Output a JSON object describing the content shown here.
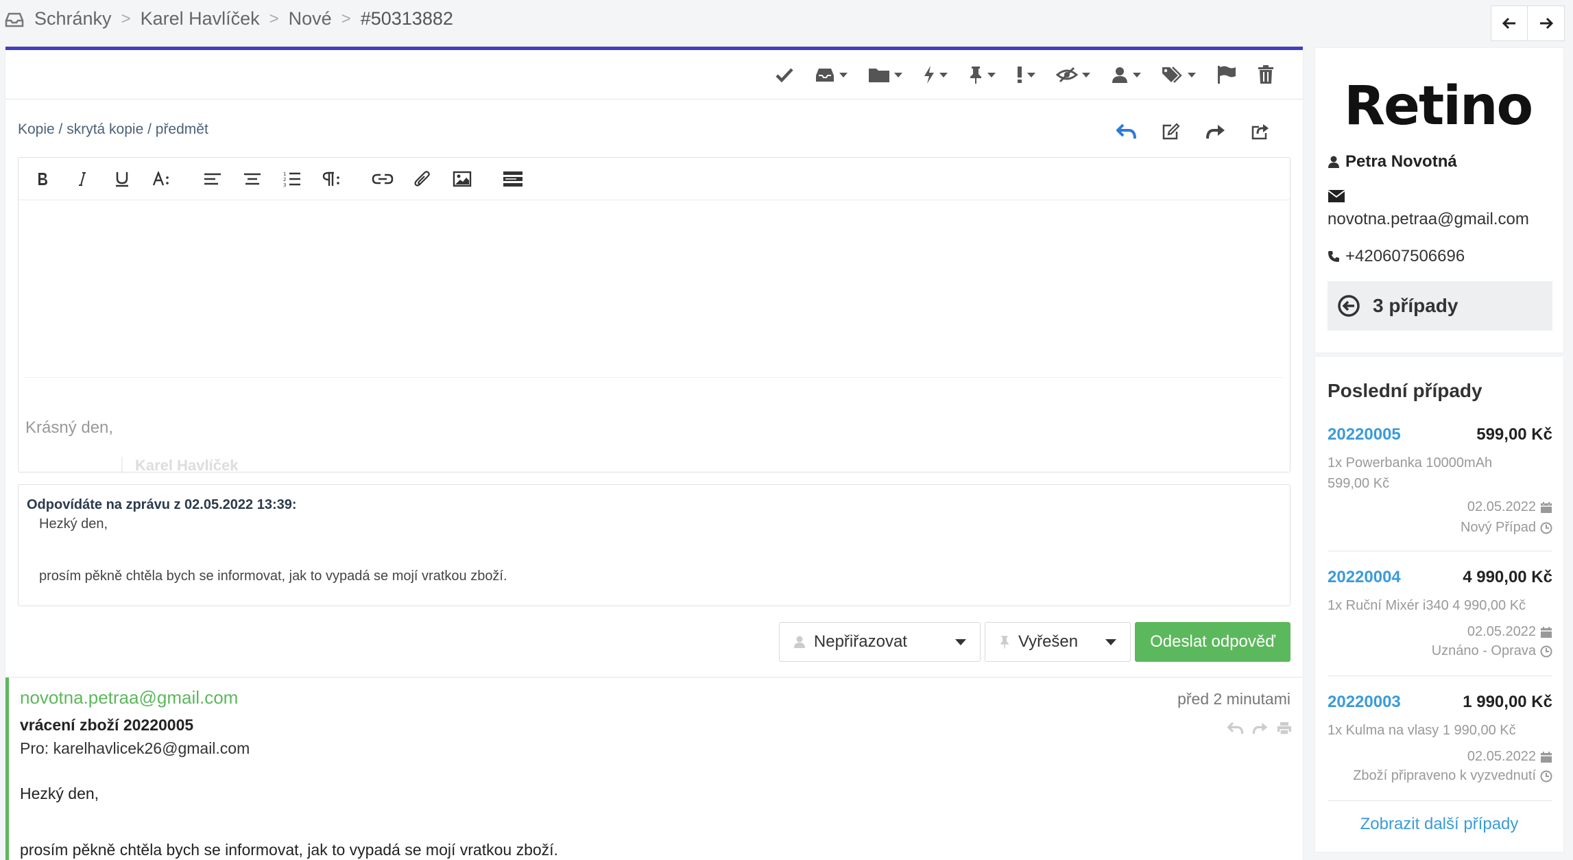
{
  "breadcrumb": [
    "Schránky",
    "Karel Havlíček",
    "Nové",
    "#50313882"
  ],
  "composer": {
    "recipients_link": "Kopie / skrytá kopie / předmět",
    "signature_greeting": "Krásný den,",
    "signature_name": "Karel Havlíček"
  },
  "quoted": {
    "header": "Odpovídáte na zprávu z 02.05.2022 13:39:",
    "line1": "Hezký den,",
    "line2": "prosím pěkně chtěla bych se informovat, jak to vypadá se mojí vratkou zboží."
  },
  "actions": {
    "assign_label": "Nepřiřazovat",
    "status_label": "Vyřešen",
    "send_label": "Odeslat odpověď"
  },
  "message": {
    "from": "novotna.petraa@gmail.com",
    "time": "před 2 minutami",
    "subject": "vrácení zboží 20220005",
    "to": "Pro: karelhavlicek26@gmail.com",
    "body1": "Hezký den,",
    "body2": "prosím pěkně chtěla bych se informovat, jak to vypadá se mojí vratkou zboží."
  },
  "customer": {
    "logo": "Retino",
    "name": "Petra Novotná",
    "email": "novotna.petraa@gmail.com",
    "phone": "+420607506696",
    "cases_count": "3 případy"
  },
  "recent": {
    "title": "Poslední případy",
    "cases": [
      {
        "id": "20220005",
        "price": "599,00 Kč",
        "desc": "1x Powerbanka 10000mAh 599,00 Kč",
        "date": "02.05.2022",
        "status": "Nový Případ"
      },
      {
        "id": "20220004",
        "price": "4 990,00 Kč",
        "desc": "1x Ruční Mixér i340 4 990,00 Kč",
        "date": "02.05.2022",
        "status": "Uznáno - Oprava"
      },
      {
        "id": "20220003",
        "price": "1 990,00 Kč",
        "desc": "1x Kulma na vlasy 1 990,00 Kč",
        "date": "02.05.2022",
        "status": "Zboží připraveno k vyzvednutí"
      }
    ],
    "more_link": "Zobrazit další případy"
  },
  "colors": {
    "accent_bar": "#3f3fc4",
    "green": "#5cb85c",
    "link_blue": "#3a9bd9",
    "reply_blue": "#2f7ad6"
  },
  "icons": {
    "toolbar": [
      "check-icon",
      "inbox-icon",
      "folder-icon",
      "bolt-icon",
      "pin-icon",
      "exclamation-icon",
      "eye-slash-icon",
      "user-icon",
      "tags-icon",
      "flag-icon",
      "trash-icon"
    ],
    "reply": [
      "reply-icon",
      "edit-icon",
      "forward-icon",
      "share-icon"
    ]
  }
}
